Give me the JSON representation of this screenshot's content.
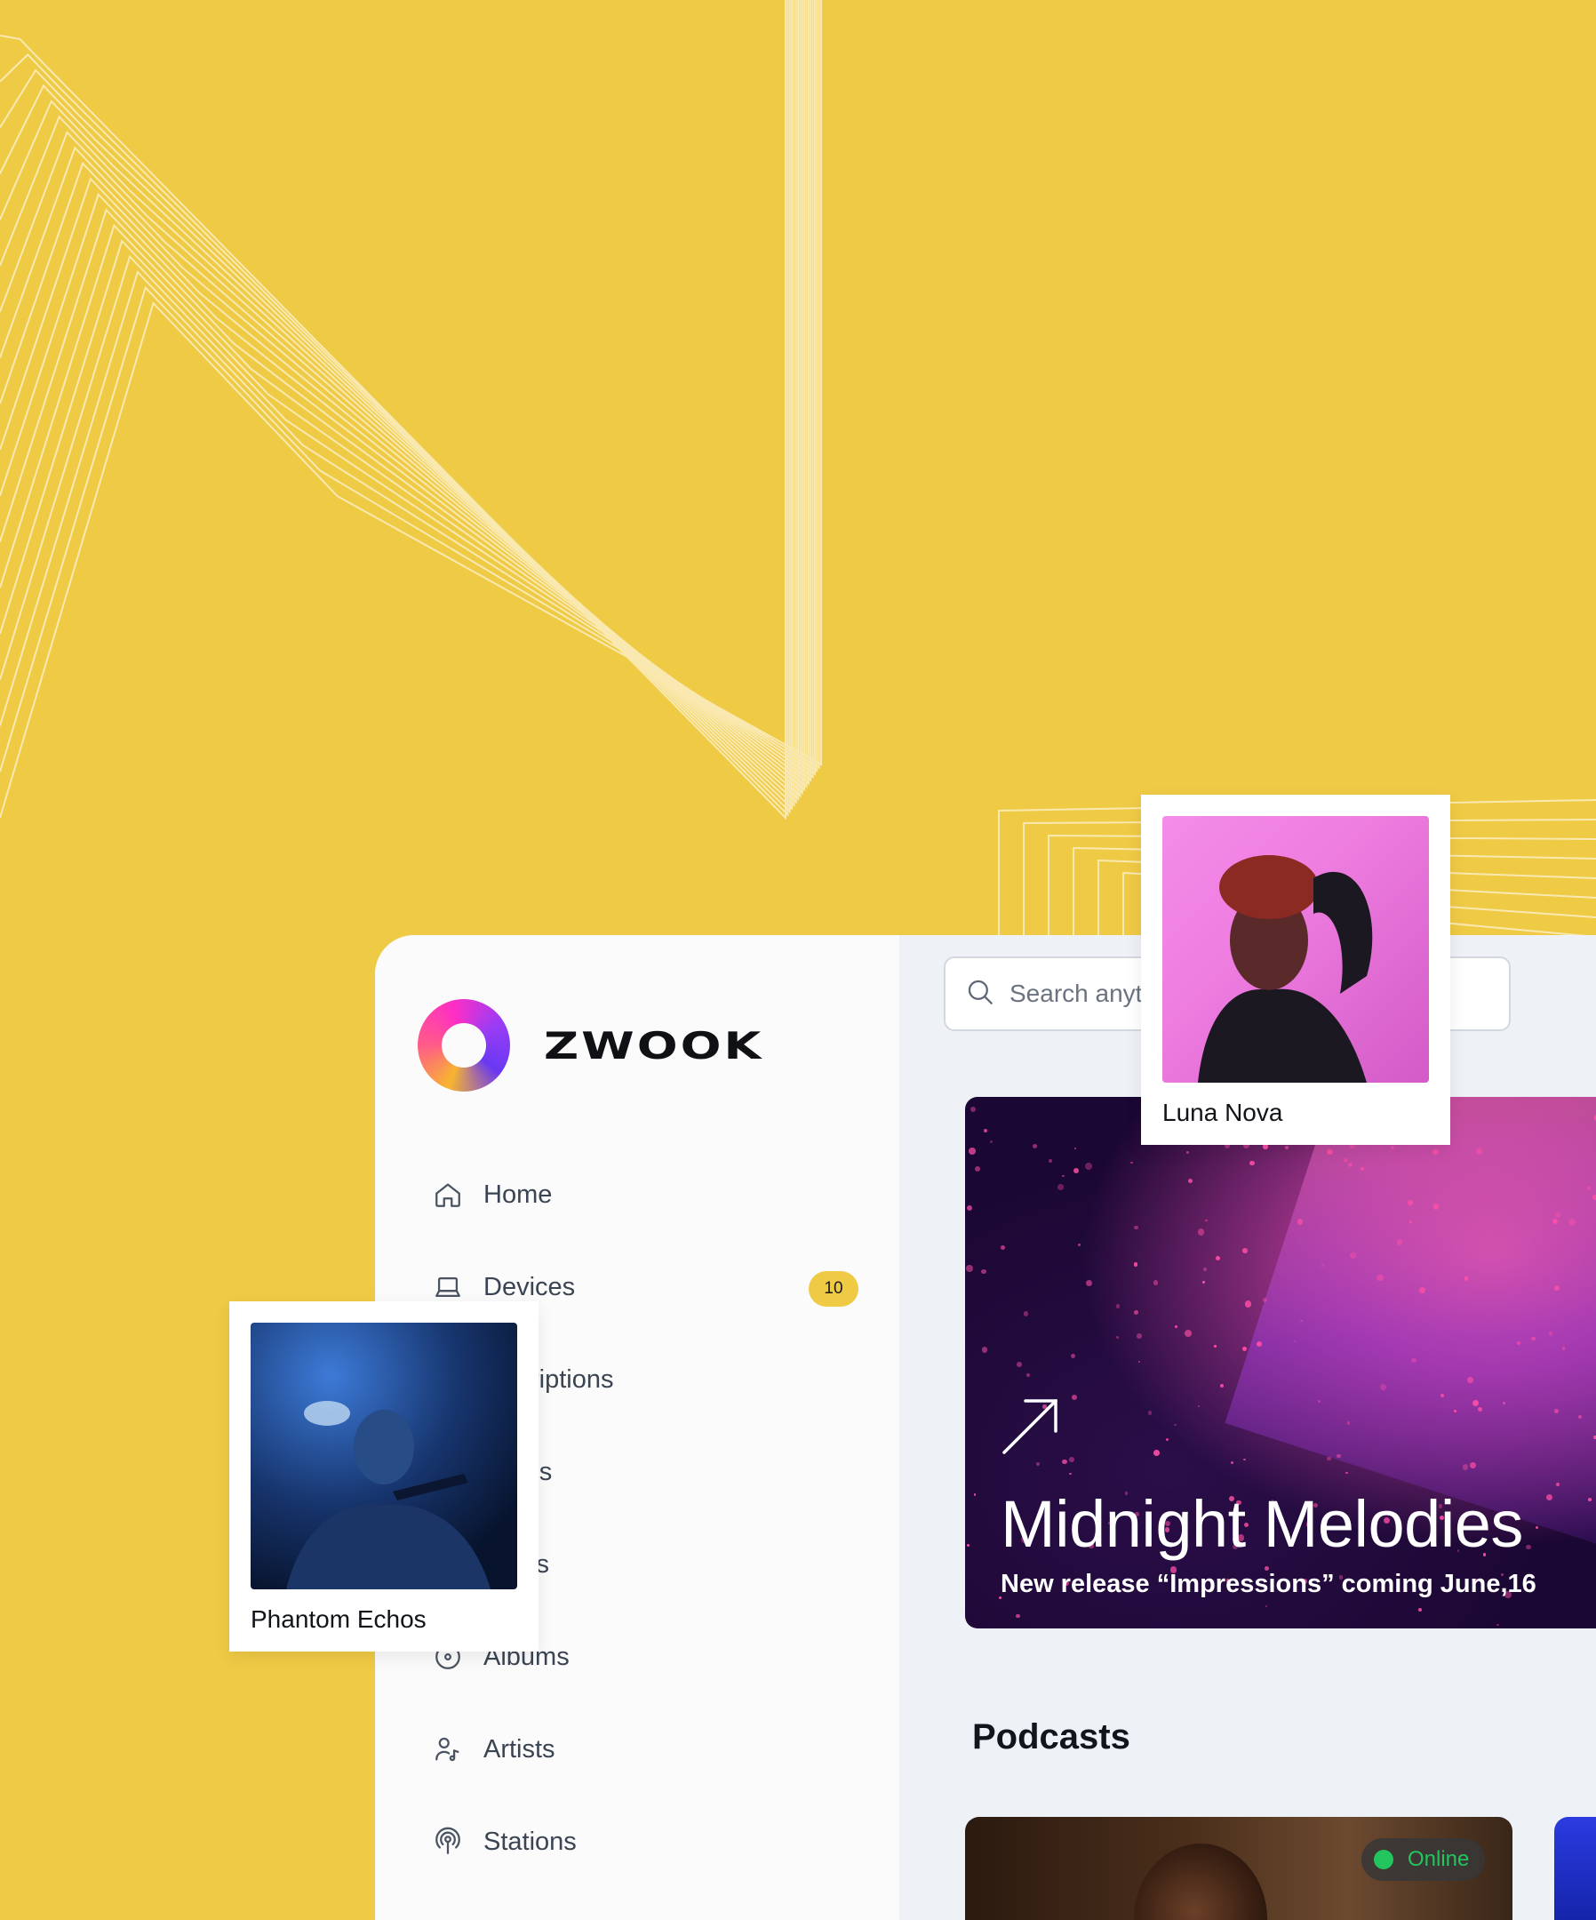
{
  "app": {
    "logo_text": "ZWOOK"
  },
  "sidebar": {
    "items": [
      {
        "label": "Home",
        "icon": "home-icon"
      },
      {
        "label": "Devices",
        "icon": "laptop-icon",
        "badge": "10"
      },
      {
        "label": "Subscriptions",
        "visible_label": "scriptions",
        "icon": "subscriptions-icon"
      },
      {
        "label": "Recordings",
        "visible_label": "ings",
        "icon": "recordings-icon"
      },
      {
        "label": "Playlists",
        "visible_label": "lists",
        "icon": "playlists-icon"
      },
      {
        "label": "Albums",
        "icon": "album-icon"
      },
      {
        "label": "Artists",
        "icon": "artist-icon"
      },
      {
        "label": "Stations",
        "icon": "broadcast-icon"
      }
    ]
  },
  "search": {
    "placeholder": "Search anything"
  },
  "hero": {
    "title": "Midnight Melodies",
    "subtitle": "New release “Impressions” coming June,16"
  },
  "podcasts": {
    "title": "Podcasts",
    "status": "Online"
  },
  "floating_cards": {
    "luna": "Luna Nova",
    "phantom": "Phantom Echos"
  },
  "colors": {
    "background": "#EFCA45",
    "badge": "#EFCA45",
    "online": "#22C55E",
    "sidebar": "#FBFBFB",
    "main": "#EEF1F6"
  }
}
